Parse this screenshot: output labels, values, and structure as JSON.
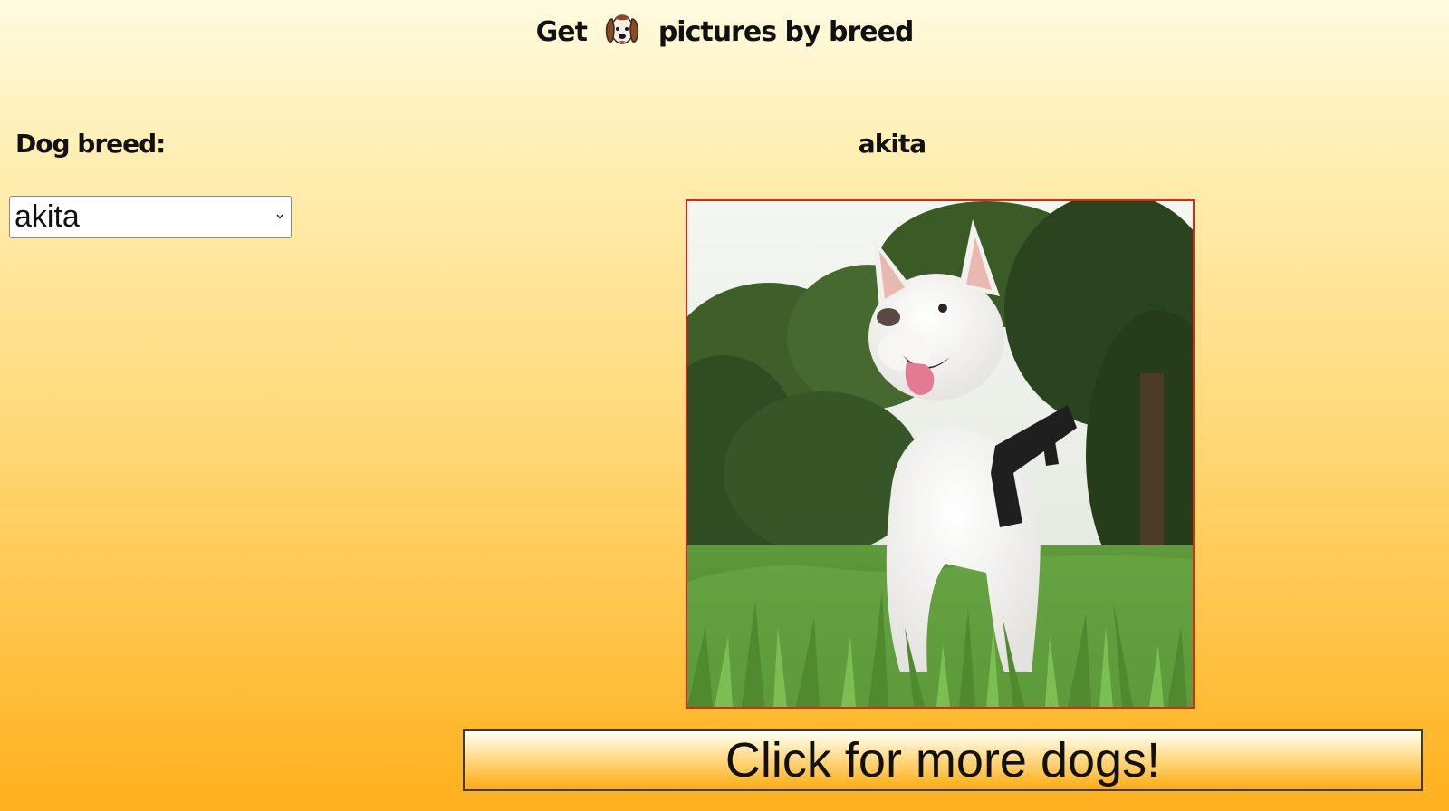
{
  "header": {
    "title_before": "Get",
    "title_icon": "dog-face-icon",
    "title_after": "pictures by breed"
  },
  "sidebar": {
    "breed_label": "Dog breed:",
    "breed_select_value": "akita"
  },
  "main": {
    "breed_heading": "akita",
    "photo_alt": "akita",
    "more_button_label": "Click for more dogs!"
  },
  "colors": {
    "photo_border": "#e0251b",
    "background_top": "#fffbe0",
    "background_bottom": "#ffb01c"
  }
}
